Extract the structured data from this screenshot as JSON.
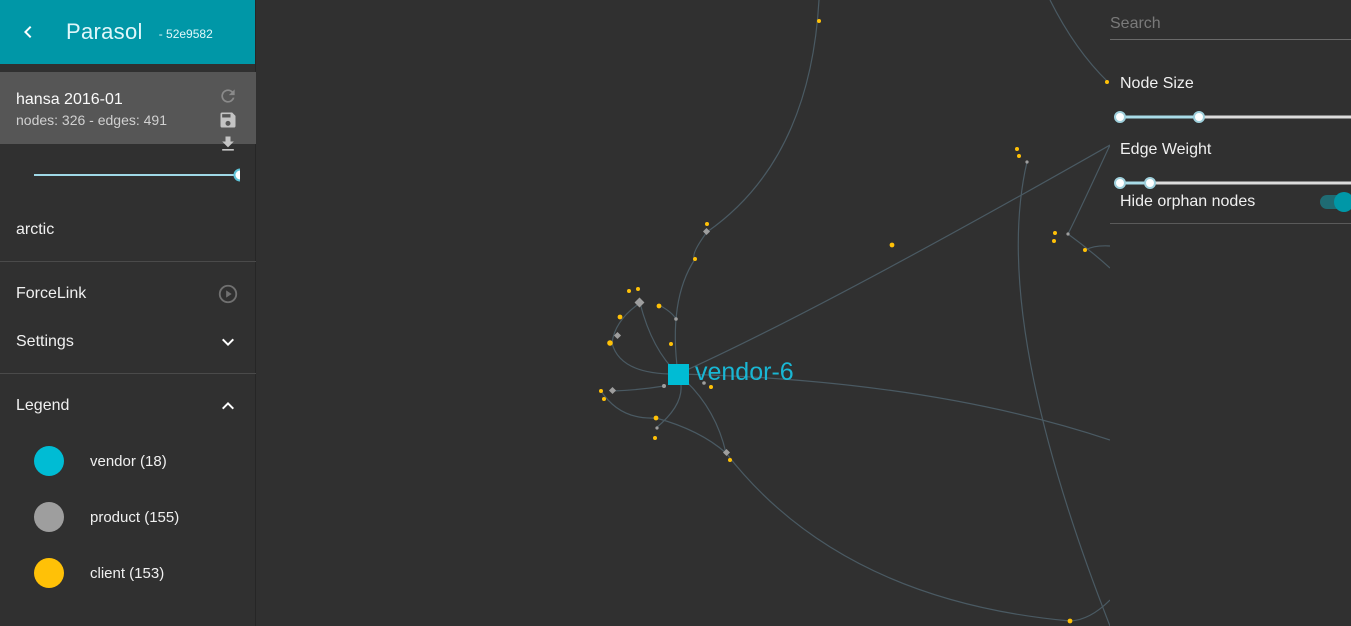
{
  "app": {
    "title": "Parasol",
    "version": "- 52e9582"
  },
  "graph": {
    "name": "hansa 2016-01",
    "stats": "nodes: 326 - edges: 491",
    "actions": [
      "refresh-icon",
      "save-icon",
      "download-icon"
    ]
  },
  "range_slider": {
    "min_fraction": 1.0,
    "max_fraction": 1.0
  },
  "filter": {
    "text": "arctic"
  },
  "layout": {
    "label": "ForceLink",
    "icon": "play-circle-icon"
  },
  "settings": {
    "label": "Settings",
    "icon": "chevron-down-icon",
    "expanded": false
  },
  "legend": {
    "label": "Legend",
    "icon": "chevron-up-icon",
    "expanded": true,
    "items": [
      {
        "label": "vendor (18)",
        "color": "#00bcd4"
      },
      {
        "label": "product (155)",
        "color": "#9e9e9e"
      },
      {
        "label": "client (153)",
        "color": "#ffc107"
      }
    ]
  },
  "canvas": {
    "highlighted_node": "vendor-6",
    "colors": {
      "vendor": "#00bcd4",
      "product": "#9e9e9e",
      "client": "#ffc107",
      "edge": "#4a5a63",
      "background": "#303030"
    }
  },
  "panel": {
    "search_placeholder": "Search",
    "node_size": {
      "label": "Node Size",
      "low_fraction": 0.0,
      "high_fraction": 0.33
    },
    "edge_weight": {
      "label": "Edge Weight",
      "low_fraction": 0.0,
      "high_fraction": 0.125
    },
    "hide_orphans": {
      "label": "Hide orphan nodes",
      "checked": true
    }
  },
  "accent_color": "#0097a7"
}
